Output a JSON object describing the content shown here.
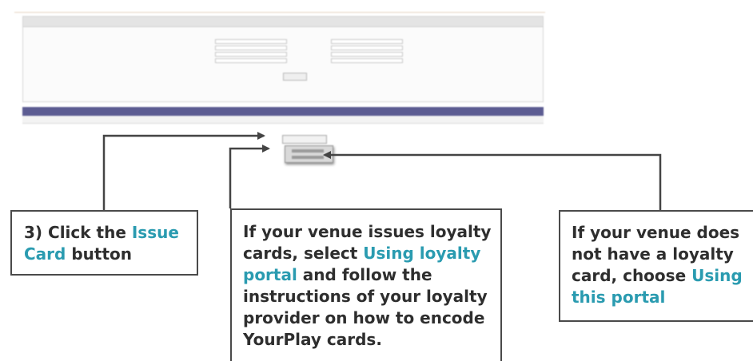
{
  "callouts": {
    "step": {
      "lead": "3) Click the ",
      "highlight": "Issue Card",
      "tail": " button"
    },
    "loyalty_portal": {
      "lead": "If your venue issues loyalty cards, select ",
      "highlight": "Using loyalty portal",
      "tail": " and follow the instructions of your loyalty provider on how to encode YourPlay cards."
    },
    "this_portal": {
      "lead": "If your venue does not have a loyalty card, choose ",
      "highlight": "Using this portal"
    }
  },
  "colors": {
    "highlight": "#2a9bb0",
    "callout_text": "#2e2e2e",
    "callout_border": "#4a4a4a",
    "arrow": "#444444",
    "table_header": "#5c5c92"
  }
}
